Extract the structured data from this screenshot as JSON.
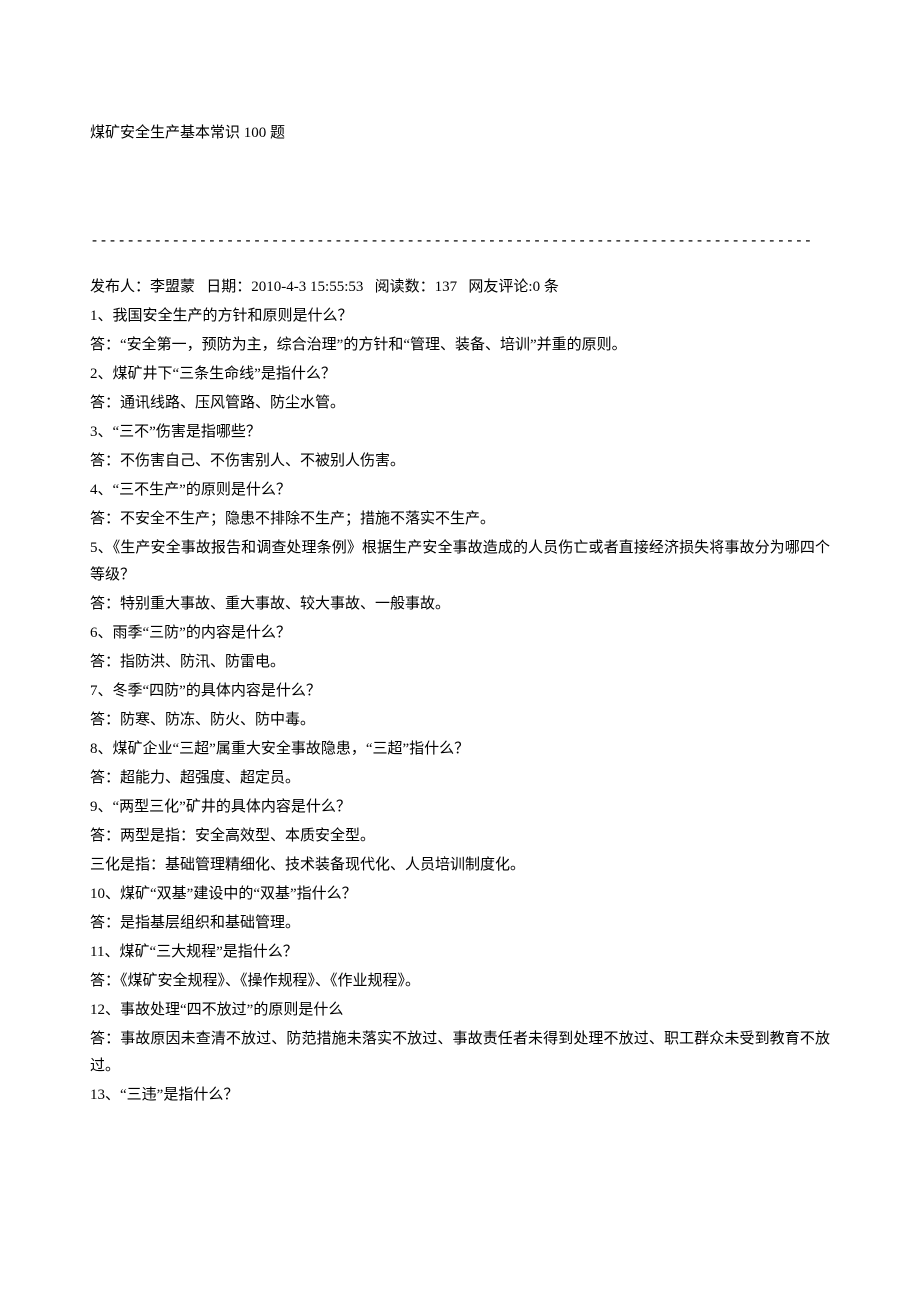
{
  "title": "煤矿安全生产基本常识 100 题",
  "divider": "--------------------------------------------------------------------------------",
  "meta": {
    "publisher_label": "发布人：",
    "publisher": "李盟蒙",
    "date_label": "日期：",
    "date": "2010-4-3 15:55:53",
    "reads_label": "阅读数：",
    "reads": "137",
    "comments_label": "网友评论:",
    "comments": "0 条"
  },
  "lines": [
    "1、我国安全生产的方针和原则是什么？",
    "答：“安全第一，预防为主，综合治理”的方针和“管理、装备、培训”并重的原则。",
    "2、煤矿井下“三条生命线”是指什么？",
    "答：通讯线路、压风管路、防尘水管。",
    "3、“三不”伤害是指哪些？",
    "答：不伤害自己、不伤害别人、不被别人伤害。",
    "4、“三不生产”的原则是什么？",
    "答：不安全不生产；隐患不排除不生产；措施不落实不生产。",
    "5、《生产安全事故报告和调查处理条例》根据生产安全事故造成的人员伤亡或者直接经济损失将事故分为哪四个等级？",
    "答：特别重大事故、重大事故、较大事故、一般事故。",
    "6、雨季“三防”的内容是什么？",
    "答：指防洪、防汛、防雷电。",
    "7、冬季“四防”的具体内容是什么？",
    "答：防寒、防冻、防火、防中毒。",
    "8、煤矿企业“三超”属重大安全事故隐患，“三超”指什么？",
    "答：超能力、超强度、超定员。",
    "9、“两型三化”矿井的具体内容是什么？",
    "答：两型是指：安全高效型、本质安全型。",
    "三化是指：基础管理精细化、技术装备现代化、人员培训制度化。",
    "10、煤矿“双基”建设中的“双基”指什么？",
    "答：是指基层组织和基础管理。",
    "11、煤矿“三大规程”是指什么？",
    "答：《煤矿安全规程》、《操作规程》、《作业规程》。",
    "12、事故处理“四不放过”的原则是什么",
    "答：事故原因未查清不放过、防范措施未落实不放过、事故责任者未得到处理不放过、职工群众未受到教育不放过。",
    "13、“三违”是指什么？"
  ]
}
